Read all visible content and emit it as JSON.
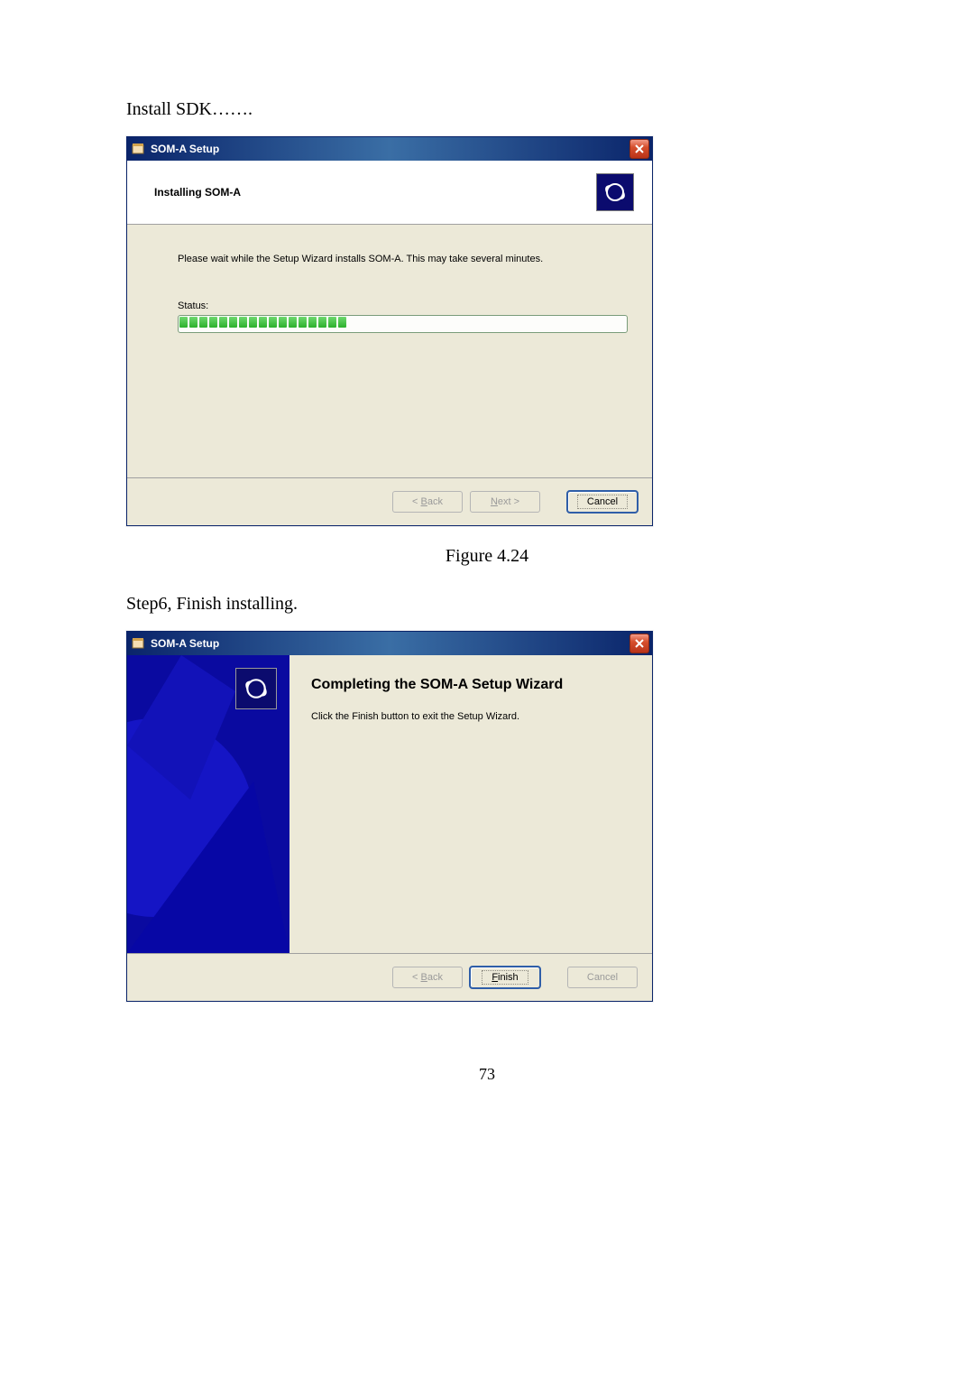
{
  "page": {
    "intro": "Install SDK…….",
    "figure_caption": "Figure 4.24",
    "step6": "Step6, Finish installing.",
    "page_number": "73"
  },
  "dialog1": {
    "title": "SOM-A Setup",
    "header": "Installing SOM-A",
    "message": "Please wait while the Setup Wizard installs SOM-A.  This may take several minutes.",
    "status_label": "Status:",
    "progress_blocks": 17,
    "buttons": {
      "back_prefix": "< ",
      "back_mn": "B",
      "back_suffix": "ack",
      "next_mn": "N",
      "next_suffix": "ext >",
      "cancel": "Cancel"
    }
  },
  "dialog2": {
    "title": "SOM-A Setup",
    "heading": "Completing the SOM-A Setup Wizard",
    "description": "Click the Finish button to exit the Setup Wizard.",
    "buttons": {
      "back_prefix": "< ",
      "back_mn": "B",
      "back_suffix": "ack",
      "finish_mn": "F",
      "finish_suffix": "inish",
      "cancel": "Cancel"
    }
  }
}
